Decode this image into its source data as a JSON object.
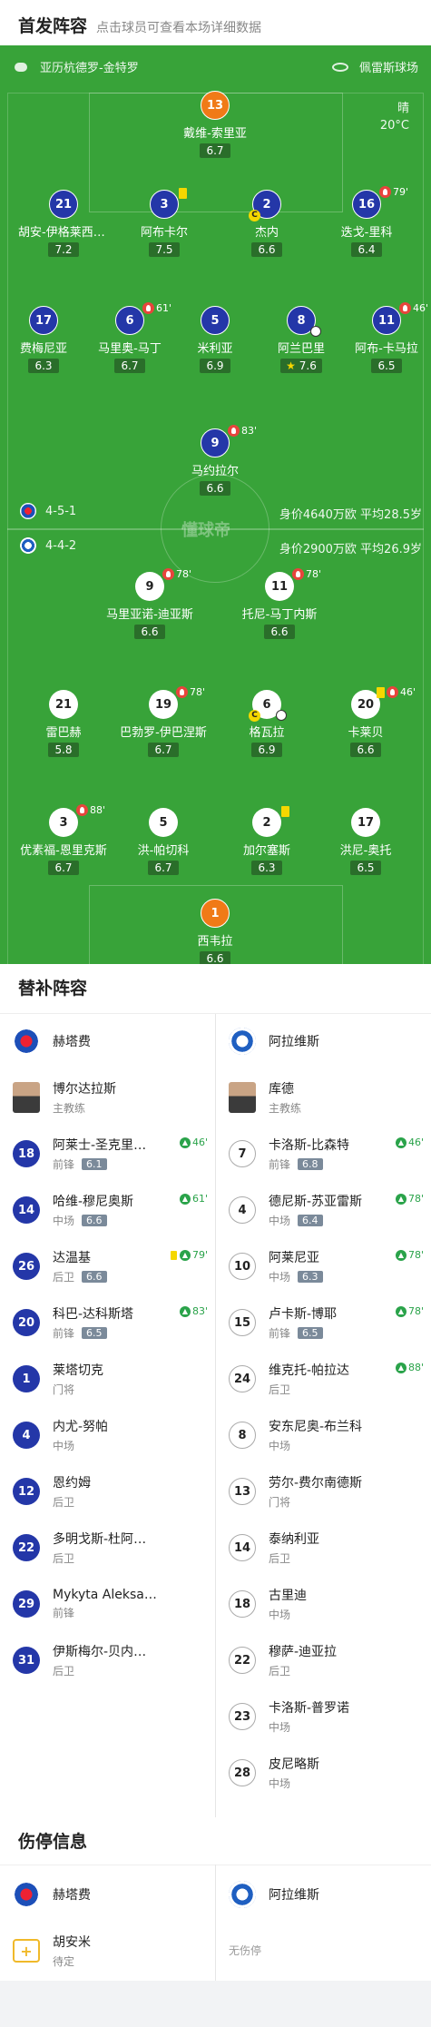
{
  "header": {
    "title": "首发阵容",
    "subtitle": "点击球员可查看本场详细数据"
  },
  "pitch": {
    "referee": "亚历杭德罗-金特罗",
    "stadium": "佩雷斯球场",
    "weather": "晴",
    "temperature": "20°C",
    "watermark": "懂球帝",
    "home_formation": "4-5-1",
    "home_value": "身价4640万欧 平均28.5岁",
    "away_formation": "4-4-2",
    "away_value": "身价2900万欧 平均26.9岁"
  },
  "home_players": [
    {
      "num": "13",
      "name": "戴维-索里亚",
      "rating": "6.7"
    },
    {
      "num": "21",
      "name": "胡安-伊格莱西亚斯",
      "rating": "7.2"
    },
    {
      "num": "3",
      "name": "阿布卡尔",
      "rating": "7.5"
    },
    {
      "num": "2",
      "name": "杰内",
      "rating": "6.6"
    },
    {
      "num": "16",
      "name": "迭戈-里科",
      "rating": "6.4",
      "sub_min": "79'"
    },
    {
      "num": "17",
      "name": "费梅尼亚",
      "rating": "6.3"
    },
    {
      "num": "6",
      "name": "马里奥-马丁",
      "rating": "6.7",
      "sub_min": "61'"
    },
    {
      "num": "5",
      "name": "米利亚",
      "rating": "6.9"
    },
    {
      "num": "8",
      "name": "阿兰巴里",
      "rating": "7.6"
    },
    {
      "num": "11",
      "name": "阿布-卡马拉",
      "rating": "6.5",
      "sub_min": "46'"
    },
    {
      "num": "9",
      "name": "马约拉尔",
      "rating": "6.6",
      "sub_min": "83'"
    }
  ],
  "away_players": [
    {
      "num": "9",
      "name": "马里亚诺-迪亚斯",
      "rating": "6.6",
      "sub_min": "78'"
    },
    {
      "num": "11",
      "name": "托尼-马丁内斯",
      "rating": "6.6",
      "sub_min": "78'"
    },
    {
      "num": "21",
      "name": "雷巴赫",
      "rating": "5.8"
    },
    {
      "num": "19",
      "name": "巴勃罗-伊巴涅斯",
      "rating": "6.7",
      "sub_min": "78'"
    },
    {
      "num": "6",
      "name": "格瓦拉",
      "rating": "6.9"
    },
    {
      "num": "20",
      "name": "卡莱贝",
      "rating": "6.6",
      "sub_min": "46'"
    },
    {
      "num": "3",
      "name": "优素福-恩里克斯",
      "rating": "6.7",
      "sub_min": "88'"
    },
    {
      "num": "5",
      "name": "洪-帕切科",
      "rating": "6.7"
    },
    {
      "num": "2",
      "name": "加尔塞斯",
      "rating": "6.3"
    },
    {
      "num": "17",
      "name": "洪尼-奥托",
      "rating": "6.5"
    },
    {
      "num": "1",
      "name": "西韦拉",
      "rating": "6.6"
    }
  ],
  "subs": {
    "title": "替补阵容",
    "home_team": "赫塔费",
    "away_team": "阿拉维斯",
    "home_coach": {
      "name": "博尔达拉斯",
      "role": "主教练"
    },
    "away_coach": {
      "name": "库德",
      "role": "主教练"
    },
    "home": [
      {
        "num": "18",
        "name": "阿莱士-圣克里斯托",
        "pos": "前锋",
        "rating": "6.1",
        "in": "46'"
      },
      {
        "num": "14",
        "name": "哈维-穆尼奥斯",
        "pos": "中场",
        "rating": "6.6",
        "in": "61'"
      },
      {
        "num": "26",
        "name": "达温基",
        "pos": "后卫",
        "rating": "6.6",
        "in": "79'"
      },
      {
        "num": "20",
        "name": "科巴-达科斯塔",
        "pos": "前锋",
        "rating": "6.5",
        "in": "83'"
      },
      {
        "num": "1",
        "name": "莱塔切克",
        "pos": "门将"
      },
      {
        "num": "4",
        "name": "内尤-努帕",
        "pos": "中场"
      },
      {
        "num": "12",
        "name": "恩约姆",
        "pos": "后卫"
      },
      {
        "num": "22",
        "name": "多明戈斯-杜阿尔特",
        "pos": "后卫"
      },
      {
        "num": "29",
        "name": "Mykyta Aleksandrov",
        "pos": "前锋"
      },
      {
        "num": "31",
        "name": "伊斯梅尔-贝内加斯",
        "pos": "后卫"
      }
    ],
    "away": [
      {
        "num": "7",
        "name": "卡洛斯-比森特",
        "pos": "前锋",
        "rating": "6.8",
        "in": "46'"
      },
      {
        "num": "4",
        "name": "德尼斯-苏亚雷斯",
        "pos": "中场",
        "rating": "6.4",
        "in": "78'"
      },
      {
        "num": "10",
        "name": "阿莱尼亚",
        "pos": "中场",
        "rating": "6.3",
        "in": "78'"
      },
      {
        "num": "15",
        "name": "卢卡斯-博耶",
        "pos": "前锋",
        "rating": "6.5",
        "in": "78'"
      },
      {
        "num": "24",
        "name": "维克托-帕拉达",
        "pos": "后卫",
        "in": "88'"
      },
      {
        "num": "8",
        "name": "安东尼奥-布兰科",
        "pos": "中场"
      },
      {
        "num": "13",
        "name": "劳尔-费尔南德斯",
        "pos": "门将"
      },
      {
        "num": "14",
        "name": "泰纳利亚",
        "pos": "后卫"
      },
      {
        "num": "18",
        "name": "古里迪",
        "pos": "中场"
      },
      {
        "num": "22",
        "name": "穆萨-迪亚拉",
        "pos": "后卫"
      },
      {
        "num": "23",
        "name": "卡洛斯-普罗诺",
        "pos": "中场"
      },
      {
        "num": "28",
        "name": "皮尼略斯",
        "pos": "中场"
      }
    ]
  },
  "injuries": {
    "title": "伤停信息",
    "home_team": "赫塔费",
    "away_team": "阿拉维斯",
    "home_player": {
      "name": "胡安米",
      "status": "待定"
    },
    "away_none": "无伤停"
  },
  "colors": {
    "pitch": "#38a339",
    "home": "#2437a8",
    "gk": "#f07a17",
    "sub_in": "#2aa34a",
    "sub_out": "#e8443c",
    "card": "#f5d700"
  }
}
